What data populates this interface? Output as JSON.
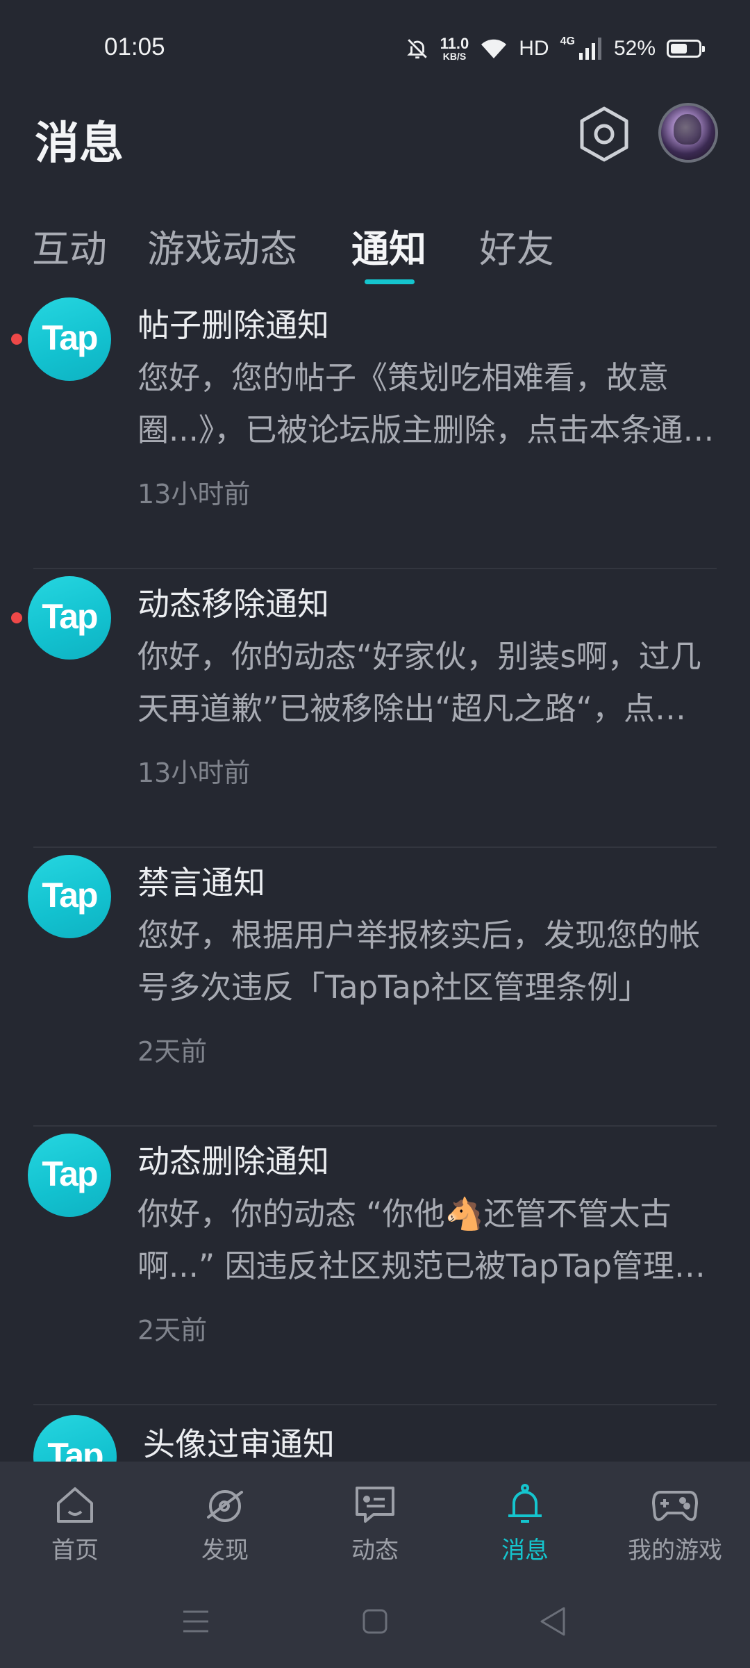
{
  "status_bar": {
    "time": "01:05",
    "net_speed": "11.0",
    "net_unit": "KB/S",
    "hd": "HD",
    "network": "4G",
    "battery": "52%",
    "battery_level": 0.52
  },
  "header": {
    "title": "消息"
  },
  "tabs": [
    {
      "label": "互动"
    },
    {
      "label": "游戏动态"
    },
    {
      "label": "通知"
    },
    {
      "label": "好友"
    }
  ],
  "active_tab": "通知",
  "notifications": [
    {
      "logo": "Tap",
      "title": "帖子删除通知",
      "body": "您好，您的帖子《策划吃相难看，故意圈...》，已被论坛版主删除，点击本条通知查看详情",
      "time": "13小时前",
      "unread": true
    },
    {
      "logo": "Tap",
      "title": "动态移除通知",
      "body": "你好，你的动态“好家伙，别装s啊，过几天再道歉”已被移除出“超凡之路“，点击查看详情",
      "time": "13小时前",
      "unread": true
    },
    {
      "logo": "Tap",
      "title": "禁言通知",
      "body": "您好，根据用户举报核实后，发现您的帐号多次违反「TapTap社区管理条例」",
      "time": "2天前",
      "unread": false
    },
    {
      "logo": "Tap",
      "title": "动态删除通知",
      "body": "你好，你的动态 “你他🐴还管不管太古啊...” 因违反社区规范已被TapTap管理员删除",
      "time": "2天前",
      "unread": false
    },
    {
      "logo": "Tap",
      "title": "头像过审通知",
      "body": "",
      "time": "",
      "unread": false
    }
  ],
  "bottom_nav": [
    {
      "label": "首页",
      "icon": "home-icon"
    },
    {
      "label": "发现",
      "icon": "discover-icon"
    },
    {
      "label": "动态",
      "icon": "moments-icon"
    },
    {
      "label": "消息",
      "icon": "bell-icon"
    },
    {
      "label": "我的游戏",
      "icon": "gamepad-icon"
    }
  ],
  "colors": {
    "background": "#252831",
    "accent": "#15c5ce",
    "unread": "#ee4848",
    "nav_bg": "#31343e"
  }
}
